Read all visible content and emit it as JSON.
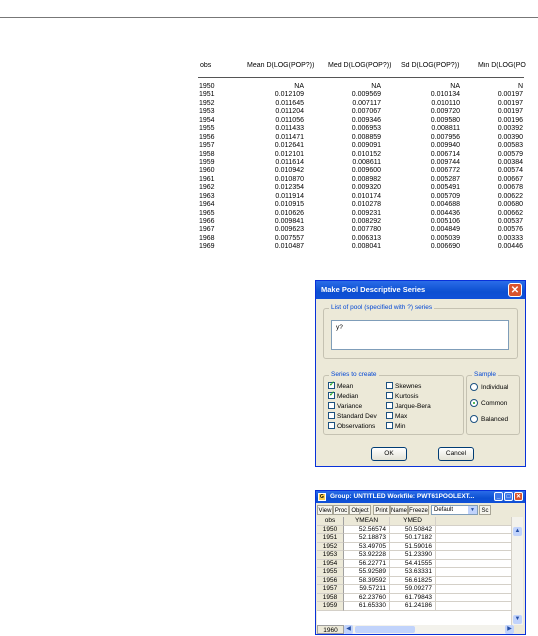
{
  "table": {
    "headers": [
      "obs",
      "Mean D(LOG(POP?))",
      "Med D(LOG(POP?))",
      "Sd D(LOG(POP?))",
      "Min D(LOG(PO"
    ],
    "rows": [
      [
        "1950",
        "NA",
        "NA",
        "NA",
        "N"
      ],
      [
        "1951",
        "0.012109",
        "0.009569",
        "0.010134",
        "0.00197"
      ],
      [
        "1952",
        "0.011645",
        "0.007117",
        "0.010110",
        "0.00197"
      ],
      [
        "1953",
        "0.011204",
        "0.007067",
        "0.009720",
        "0.00197"
      ],
      [
        "1954",
        "0.011056",
        "0.009346",
        "0.009580",
        "0.00196"
      ],
      [
        "1955",
        "0.011433",
        "0.006953",
        "0.008811",
        "0.00392"
      ],
      [
        "1956",
        "0.011471",
        "0.008859",
        "0.007956",
        "0.00390"
      ],
      [
        "1957",
        "0.012641",
        "0.009091",
        "0.009940",
        "0.00583"
      ],
      [
        "1958",
        "0.012101",
        "0.010152",
        "0.006714",
        "0.00579"
      ],
      [
        "1959",
        "0.011614",
        "0.008611",
        "0.009744",
        "0.00384"
      ],
      [
        "1960",
        "0.010942",
        "0.009600",
        "0.006772",
        "0.00574"
      ],
      [
        "1961",
        "0.010870",
        "0.008982",
        "0.005287",
        "0.00667"
      ],
      [
        "1962",
        "0.012354",
        "0.009320",
        "0.005491",
        "0.00678"
      ],
      [
        "1963",
        "0.011914",
        "0.010174",
        "0.005709",
        "0.00622"
      ],
      [
        "1964",
        "0.010915",
        "0.010278",
        "0.004688",
        "0.00680"
      ],
      [
        "1965",
        "0.010626",
        "0.009231",
        "0.004436",
        "0.00662"
      ],
      [
        "1966",
        "0.009841",
        "0.008292",
        "0.005106",
        "0.00537"
      ],
      [
        "1967",
        "0.009623",
        "0.007780",
        "0.004849",
        "0.00576"
      ],
      [
        "1968",
        "0.007557",
        "0.006313",
        "0.005039",
        "0.00333"
      ],
      [
        "1969",
        "0.010487",
        "0.008041",
        "0.006690",
        "0.00446"
      ]
    ]
  },
  "dialog": {
    "title": "Make Pool Descriptive Series",
    "close_glyph": "✕",
    "list_legend": "List of pool (specified with ?) series",
    "list_value": "y?",
    "series_legend": "Series to create",
    "checkboxes": [
      {
        "label": "Mean",
        "checked": true
      },
      {
        "label": "Median",
        "checked": true
      },
      {
        "label": "Variance",
        "checked": false
      },
      {
        "label": "Standard Dev",
        "checked": false
      },
      {
        "label": "Observations",
        "checked": false
      },
      {
        "label": "Skewnes",
        "checked": false
      },
      {
        "label": "Kurtosis",
        "checked": false
      },
      {
        "label": "Jarque-Bera",
        "checked": false
      },
      {
        "label": "Max",
        "checked": false
      },
      {
        "label": "Min",
        "checked": false
      }
    ],
    "sample_legend": "Sample",
    "radios": [
      {
        "label": "Individual",
        "selected": false
      },
      {
        "label": "Common",
        "selected": true
      },
      {
        "label": "Balanced",
        "selected": false
      }
    ],
    "ok_label": "OK",
    "cancel_label": "Cancel"
  },
  "group_window": {
    "app_icon": "G",
    "title": "Group: UNTITLED   Workfile: PWT61POOLEXT...",
    "toolbar": [
      "View",
      "Proc",
      "Object",
      "Print",
      "Name",
      "Freeze"
    ],
    "select_value": "Default",
    "toolbar_extra": "Sc",
    "columns": [
      "obs",
      "YMEAN",
      "YMED"
    ],
    "rows": [
      [
        "1950",
        "52.56574",
        "50.50842"
      ],
      [
        "1951",
        "52.18873",
        "50.17182"
      ],
      [
        "1952",
        "53.49705",
        "51.59016"
      ],
      [
        "1953",
        "53.92228",
        "51.23390"
      ],
      [
        "1954",
        "56.22771",
        "54.41555"
      ],
      [
        "1955",
        "55.92589",
        "53.63331"
      ],
      [
        "1956",
        "58.39592",
        "56.61825"
      ],
      [
        "1957",
        "59.57211",
        "59.09277"
      ],
      [
        "1958",
        "62.23760",
        "61.79843"
      ],
      [
        "1959",
        "61.65330",
        "61.24186"
      ]
    ],
    "footer_obs": "1960"
  }
}
